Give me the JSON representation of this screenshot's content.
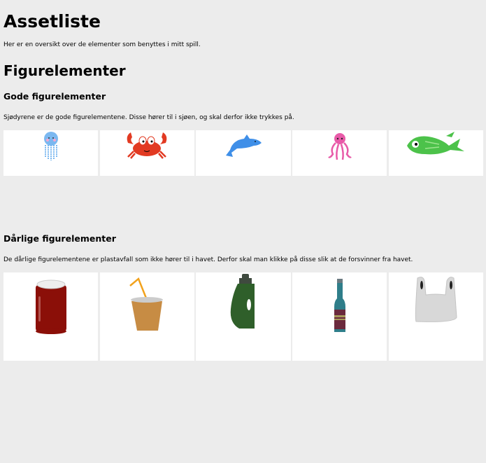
{
  "title": "Assetliste",
  "intro": "Her er en oversikt over de elementer som benyttes i mitt spill.",
  "section_title": "Figurelementer",
  "good": {
    "heading": "Gode figurelementer",
    "description": "Sjødyrene er de gode figurelementene. Disse hører til i sjøen, og skal derfor ikke trykkes på.",
    "items": [
      "jellyfish",
      "crab",
      "dolphin",
      "octopus",
      "fish"
    ]
  },
  "bad": {
    "heading": "Dårlige figurelementer",
    "description": "De dårlige figurelementene er plastavfall som ikke hører til i havet. Derfor skal man klikke på disse slik at de forsvinner fra havet.",
    "items": [
      "soda-can",
      "cup-with-straw",
      "detergent-bottle",
      "glass-bottle",
      "plastic-bag"
    ]
  },
  "colors": {
    "background": "#ececec",
    "cell": "#ffffff"
  }
}
